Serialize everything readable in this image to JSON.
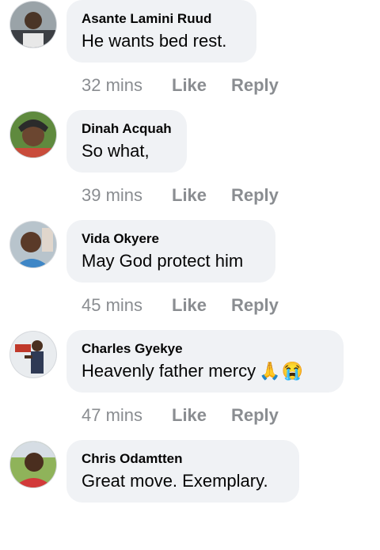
{
  "comments": [
    {
      "author": "Asante Lamini Ruud",
      "text": "He wants bed rest.",
      "time": "32 mins",
      "like": "Like",
      "reply": "Reply",
      "emoji": ""
    },
    {
      "author": "Dinah Acquah",
      "text": "So what,",
      "time": "39 mins",
      "like": "Like",
      "reply": "Reply",
      "emoji": ""
    },
    {
      "author": "Vida Okyere",
      "text": "May God protect him",
      "time": "45 mins",
      "like": "Like",
      "reply": "Reply",
      "emoji": ""
    },
    {
      "author": "Charles Gyekye",
      "text": "Heavenly father mercy",
      "time": "47 mins",
      "like": "Like",
      "reply": "Reply",
      "emoji": "🙏😭"
    },
    {
      "author": "Chris Odamtten",
      "text": "Great move. Exemplary.",
      "time": "",
      "like": "",
      "reply": "",
      "emoji": ""
    }
  ],
  "icons": {
    "emoji_1": "folded-hands-icon",
    "emoji_2": "loudly-crying-face-icon"
  }
}
